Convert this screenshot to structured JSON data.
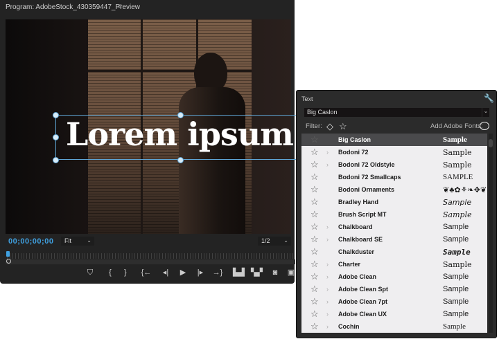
{
  "program": {
    "title": "Program: AdobeStock_430359447_Preview",
    "menu_icon": "hamburger-icon",
    "overlay_text": "Lorem ipsum",
    "timecode": "00;00;00;00",
    "zoom_select": "Fit",
    "resolution_select": "1/2",
    "playhead_position": 0,
    "controls": [
      {
        "name": "add-marker",
        "glyph": "⛉"
      },
      {
        "name": "mark-in",
        "glyph": "{"
      },
      {
        "name": "mark-out",
        "glyph": "}"
      },
      {
        "name": "go-to-in",
        "glyph": "{←"
      },
      {
        "name": "step-back",
        "glyph": "◂|"
      },
      {
        "name": "play",
        "glyph": "▶"
      },
      {
        "name": "step-forward",
        "glyph": "|▸"
      },
      {
        "name": "go-to-out",
        "glyph": "→}"
      },
      {
        "name": "lift",
        "glyph": "▙▟"
      },
      {
        "name": "extract",
        "glyph": "▚▞"
      },
      {
        "name": "export-frame",
        "glyph": "◙"
      },
      {
        "name": "comparison-view",
        "glyph": "▣"
      }
    ],
    "accent": "#3fa0e0"
  },
  "text_panel": {
    "title": "Text",
    "selected_font": "Big Caslon",
    "filter_label": "Filter:",
    "add_fonts_label": "Add Adobe Fonts:",
    "fonts": [
      {
        "name": "Big Caslon",
        "expandable": false,
        "sample": "Sample",
        "selected": true
      },
      {
        "name": "Bodoni 72",
        "expandable": true,
        "sample": "Sample"
      },
      {
        "name": "Bodoni 72 Oldstyle",
        "expandable": true,
        "sample": "Sample"
      },
      {
        "name": "Bodoni 72 Smallcaps",
        "expandable": false,
        "sample": "SAMPLE"
      },
      {
        "name": "Bodoni Ornaments",
        "expandable": false,
        "sample": "❦♣✿⚘❧✥❦"
      },
      {
        "name": "Bradley Hand",
        "expandable": false,
        "sample": "Sample"
      },
      {
        "name": "Brush Script MT",
        "expandable": false,
        "sample": "Sample"
      },
      {
        "name": "Chalkboard",
        "expandable": true,
        "sample": "Sample"
      },
      {
        "name": "Chalkboard SE",
        "expandable": true,
        "sample": "Sample"
      },
      {
        "name": "Chalkduster",
        "expandable": false,
        "sample": "Sample"
      },
      {
        "name": "Charter",
        "expandable": true,
        "sample": "Sample"
      },
      {
        "name": "Adobe Clean",
        "expandable": true,
        "sample": "Sample"
      },
      {
        "name": "Adobe Clean Spt",
        "expandable": true,
        "sample": "Sample"
      },
      {
        "name": "Adobe Clean 7pt",
        "expandable": true,
        "sample": "Sample"
      },
      {
        "name": "Adobe Clean UX",
        "expandable": true,
        "sample": "Sample"
      },
      {
        "name": "Cochin",
        "expandable": true,
        "sample": "Sample"
      }
    ]
  }
}
